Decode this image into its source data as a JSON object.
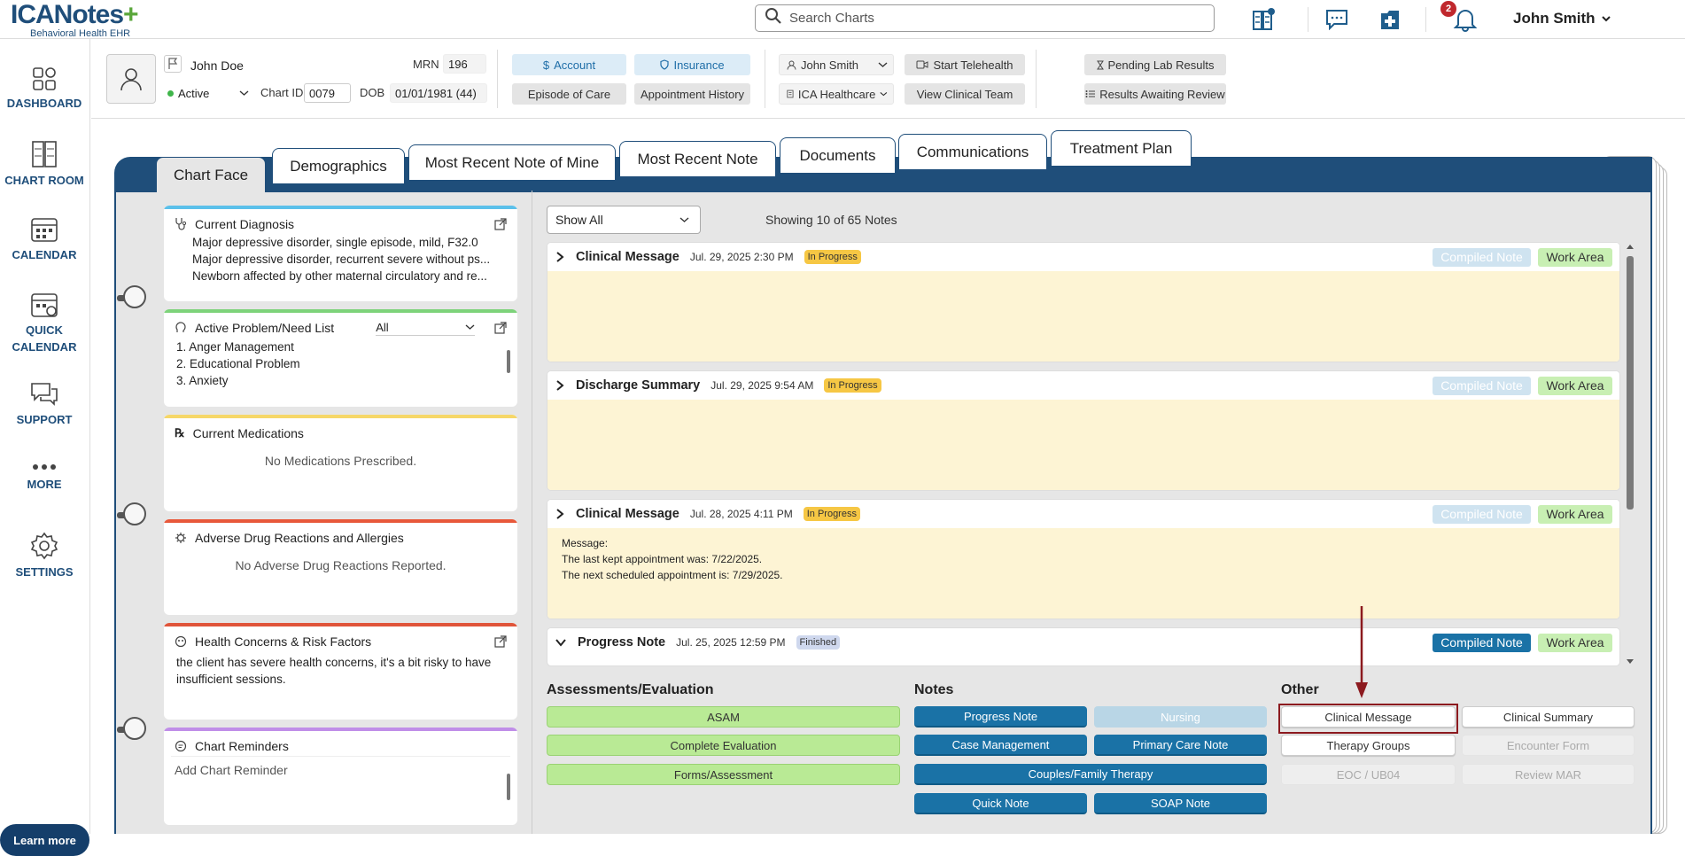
{
  "header": {
    "logo_text_a": "ICA",
    "logo_text_b": "Notes",
    "logo_sub": "Behavioral Health EHR",
    "search_placeholder": "Search Charts",
    "notification_count": "2",
    "user_name": "John Smith"
  },
  "sidebar": {
    "items": [
      {
        "label": "DASHBOARD"
      },
      {
        "label": "CHART ROOM"
      },
      {
        "label": "CALENDAR"
      },
      {
        "label": "QUICK\nCALENDAR",
        "line1": "QUICK",
        "line2": "CALENDAR"
      },
      {
        "label": "SUPPORT"
      },
      {
        "label": "MORE"
      },
      {
        "label": "SETTINGS"
      }
    ],
    "learn_more": "Learn more"
  },
  "patient": {
    "name": "John Doe",
    "status": "Active",
    "mrn_label": "MRN",
    "mrn": "196",
    "chart_id_label": "Chart ID",
    "chart_id": "0079",
    "dob_label": "DOB",
    "dob": "01/01/1981 (44)",
    "account": "Account",
    "insurance": "Insurance",
    "episode_of_care": "Episode of Care",
    "appointment_history": "Appointment History",
    "clinician": "John Smith",
    "office": "ICA Healthcare Offi",
    "start_telehealth": "Start Telehealth",
    "view_clinical_team": "View Clinical Team",
    "pending_lab_results": "Pending Lab Results",
    "results_awaiting_review": "Results Awaiting Review"
  },
  "tabs": [
    {
      "label": "Chart Face"
    },
    {
      "label": "Demographics"
    },
    {
      "label": "Most Recent Note of Mine"
    },
    {
      "label": "Most Recent Note"
    },
    {
      "label": "Documents"
    },
    {
      "label": "Communications"
    },
    {
      "label": "Treatment Plan"
    }
  ],
  "widgets": {
    "diagnosis": {
      "title": "Current Diagnosis",
      "items": [
        "Major depressive disorder, single episode, mild, F32.0",
        "Major depressive disorder, recurrent severe without ps...",
        "Newborn affected by other maternal circulatory and re..."
      ]
    },
    "problems": {
      "title": "Active Problem/Need List",
      "filter": "All",
      "items": [
        "1. Anger Management",
        "2. Educational Problem",
        "3. Anxiety"
      ]
    },
    "medications": {
      "title": "Current Medications",
      "empty": "No Medications Prescribed."
    },
    "allergies": {
      "title": "Adverse Drug Reactions and Allergies",
      "empty": "No Adverse Drug Reactions Reported."
    },
    "health": {
      "title": "Health Concerns & Risk Factors",
      "text": "the client has severe health concerns, it's a bit risky to have insufficient sessions."
    },
    "reminders": {
      "title": "Chart Reminders",
      "placeholder": "Add Chart Reminder"
    }
  },
  "notes": {
    "filter": "Show All",
    "showing": "Showing 10 of 65 Notes",
    "compiled_label": "Compiled Note",
    "work_label": "Work Area",
    "list": [
      {
        "title": "Clinical Message",
        "date": "Jul. 29, 2025 2:30 PM",
        "status": "In Progress"
      },
      {
        "title": "Discharge Summary",
        "date": "Jul. 29, 2025 9:54 AM",
        "status": "In Progress"
      },
      {
        "title": "Clinical Message",
        "date": "Jul. 28, 2025 4:11 PM",
        "status": "In Progress",
        "body": [
          "Message:",
          "The last kept appointment was: 7/22/2025.",
          "The next scheduled appointment is: 7/29/2025."
        ]
      },
      {
        "title": "Progress Note",
        "date": "Jul. 25, 2025 12:59 PM",
        "status": "Finished"
      }
    ]
  },
  "actions": {
    "assessments": {
      "label": "Assessments/Evaluation",
      "buttons": [
        "ASAM",
        "Complete Evaluation",
        "Forms/Assessment"
      ]
    },
    "notes": {
      "label": "Notes",
      "buttons": [
        "Progress Note",
        "Nursing",
        "Case Management",
        "Primary Care Note",
        "Couples/Family Therapy",
        "Quick Note",
        "SOAP Note"
      ]
    },
    "other": {
      "label": "Other",
      "buttons": [
        "Clinical Message",
        "Clinical Summary",
        "Therapy Groups",
        "Encounter Form",
        "EOC / UB04",
        "Review MAR"
      ]
    }
  },
  "colors": {
    "brand_navy": "#1f4e7a",
    "brand_green": "#5aa63a",
    "teal_button": "#1a72a6",
    "assessment_green": "#b9ea95",
    "highlight_red": "#8c1a1f",
    "in_progress": "#f6c744"
  }
}
